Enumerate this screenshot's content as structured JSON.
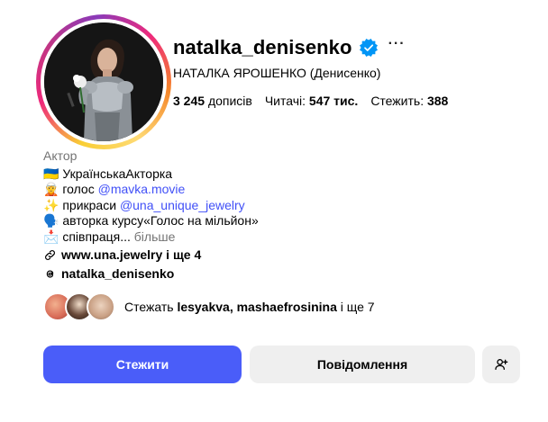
{
  "profile": {
    "username": "natalka_denisenko",
    "verified": true,
    "more_label": "···",
    "full_name": "НАТАЛКА ЯРОШЕНКО (Денисенко)"
  },
  "stats": {
    "posts_value": "3 245",
    "posts_label": "дописів",
    "followers_label": "Читачі:",
    "followers_value": "547 тис.",
    "following_label": "Стежить:",
    "following_value": "388"
  },
  "bio": {
    "category": "Актор",
    "line1_emoji": "🇺🇦",
    "line1_text": "УкраїнськаАкторка",
    "line2_emoji": "🧝",
    "line2_text": "голос ",
    "line2_mention": "@mavka.movie",
    "line3_emoji": "✨",
    "line3_text": "прикраси ",
    "line3_mention": "@una_unique_jewelry",
    "line4_emoji": "🗣️",
    "line4_text": "авторка курсу«Голос на мільйон»",
    "line5_emoji": "📩",
    "line5_text": "співпраця...",
    "line5_more": "більше",
    "website": "www.una.jewelry і ще 4",
    "threads_handle": "natalka_denisenko"
  },
  "followed_by": {
    "prefix": "Стежать",
    "names": "lesyakva, mashaefrosinina",
    "suffix": "і ще 7"
  },
  "buttons": {
    "follow": "Стежити",
    "message": "Повідомлення"
  },
  "colors": {
    "primary_button": "#4a5df9",
    "secondary_button": "#efefef",
    "mention": "#4150f7",
    "verified_badge": "#0095f6",
    "muted_text": "#737373"
  },
  "icons": {
    "verified": "verified-badge-icon",
    "more": "more-options-icon",
    "link": "link-icon",
    "threads": "threads-icon",
    "add_user": "add-user-icon"
  }
}
